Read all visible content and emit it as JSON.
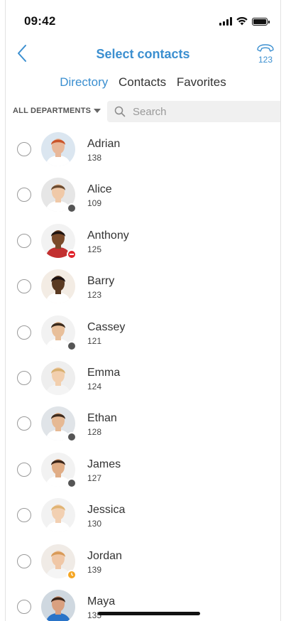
{
  "status_bar": {
    "time": "09:42"
  },
  "nav": {
    "title": "Select contacts"
  },
  "tabs": [
    {
      "label": "Directory",
      "active": true
    },
    {
      "label": "Contacts",
      "active": false
    },
    {
      "label": "Favorites",
      "active": false
    }
  ],
  "filter": {
    "department_label": "ALL DEPARTMENTS"
  },
  "search": {
    "placeholder": "Search",
    "value": ""
  },
  "colors": {
    "accent": "#3b8fd0",
    "status_offline": "#555555",
    "status_dnd": "#e0242b",
    "status_away": "#f5a623"
  },
  "contacts": [
    {
      "name": "Adrian",
      "ext": "138",
      "status": "none",
      "skin": "#e8b89a",
      "hair": "#c9542a",
      "bg": "#dbe6f0",
      "shirt": "#ffffff"
    },
    {
      "name": "Alice",
      "ext": "109",
      "status": "offline",
      "skin": "#f0c9a8",
      "hair": "#6b4a2f",
      "bg": "#e6e6e6",
      "shirt": "#ffffff"
    },
    {
      "name": "Anthony",
      "ext": "125",
      "status": "dnd",
      "skin": "#7a4a2a",
      "hair": "#1f1410",
      "bg": "#f2f2f2",
      "shirt": "#c23030"
    },
    {
      "name": "Barry",
      "ext": "123",
      "status": "none",
      "skin": "#5a3a22",
      "hair": "#1a1010",
      "bg": "#f3ece4",
      "shirt": "#ffffff"
    },
    {
      "name": "Cassey",
      "ext": "121",
      "status": "offline",
      "skin": "#e8bf9a",
      "hair": "#3a2a1c",
      "bg": "#f2f2f2",
      "shirt": "#ffffff"
    },
    {
      "name": "Emma",
      "ext": "124",
      "status": "none",
      "skin": "#f2cfae",
      "hair": "#d8b070",
      "bg": "#eeeeee",
      "shirt": "#f4f4f4"
    },
    {
      "name": "Ethan",
      "ext": "128",
      "status": "offline",
      "skin": "#e6b994",
      "hair": "#3e2b1e",
      "bg": "#e0e4e8",
      "shirt": "#ffffff"
    },
    {
      "name": "James",
      "ext": "127",
      "status": "offline",
      "skin": "#e0ad86",
      "hair": "#3a2418",
      "bg": "#f2f2f2",
      "shirt": "#ffffff"
    },
    {
      "name": "Jessica",
      "ext": "130",
      "status": "none",
      "skin": "#f2d0b2",
      "hair": "#e0b474",
      "bg": "#f2f2f2",
      "shirt": "#ffffff"
    },
    {
      "name": "Jordan",
      "ext": "139",
      "status": "away",
      "skin": "#f0c7a6",
      "hair": "#d89a58",
      "bg": "#f0ebe6",
      "shirt": "#f5f5f5"
    },
    {
      "name": "Maya",
      "ext": "135",
      "status": "none",
      "skin": "#d9a080",
      "hair": "#3a2418",
      "bg": "#cfd8e0",
      "shirt": "#2a74c8"
    }
  ]
}
